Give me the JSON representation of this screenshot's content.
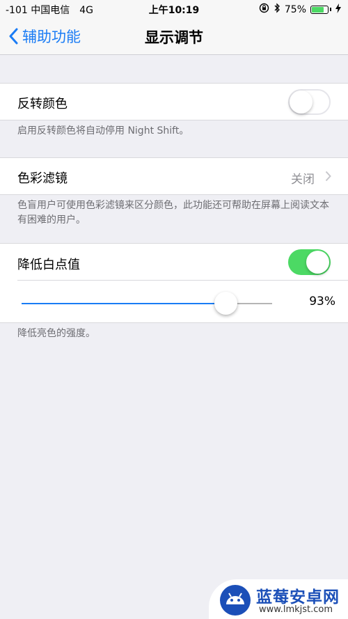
{
  "status_bar": {
    "carrier": "-101 中国电信",
    "network": "4G",
    "time": "上午10:19",
    "battery": "75%",
    "battery_level": 0.75
  },
  "nav": {
    "back_label": "辅助功能",
    "title": "显示调节"
  },
  "invert_colors": {
    "label": "反转颜色",
    "enabled": false,
    "footer": "启用反转颜色将自动停用 Night Shift。"
  },
  "color_filters": {
    "label": "色彩滤镜",
    "value": "关闭",
    "footer": "色盲用户可使用色彩滤镜来区分颜色，此功能还可帮助在屏幕上阅读文本有困难的用户。"
  },
  "reduce_white_point": {
    "label": "降低白点值",
    "enabled": true,
    "slider_value": 0.93,
    "percent_label": "93%",
    "footer": "降低亮色的强度。"
  },
  "watermark": {
    "name": "蓝莓安卓网",
    "url": "www.lmkjst.com"
  },
  "colors": {
    "accent": "#1a7cf5",
    "switch_on": "#4cd964",
    "background": "#efeff4"
  }
}
